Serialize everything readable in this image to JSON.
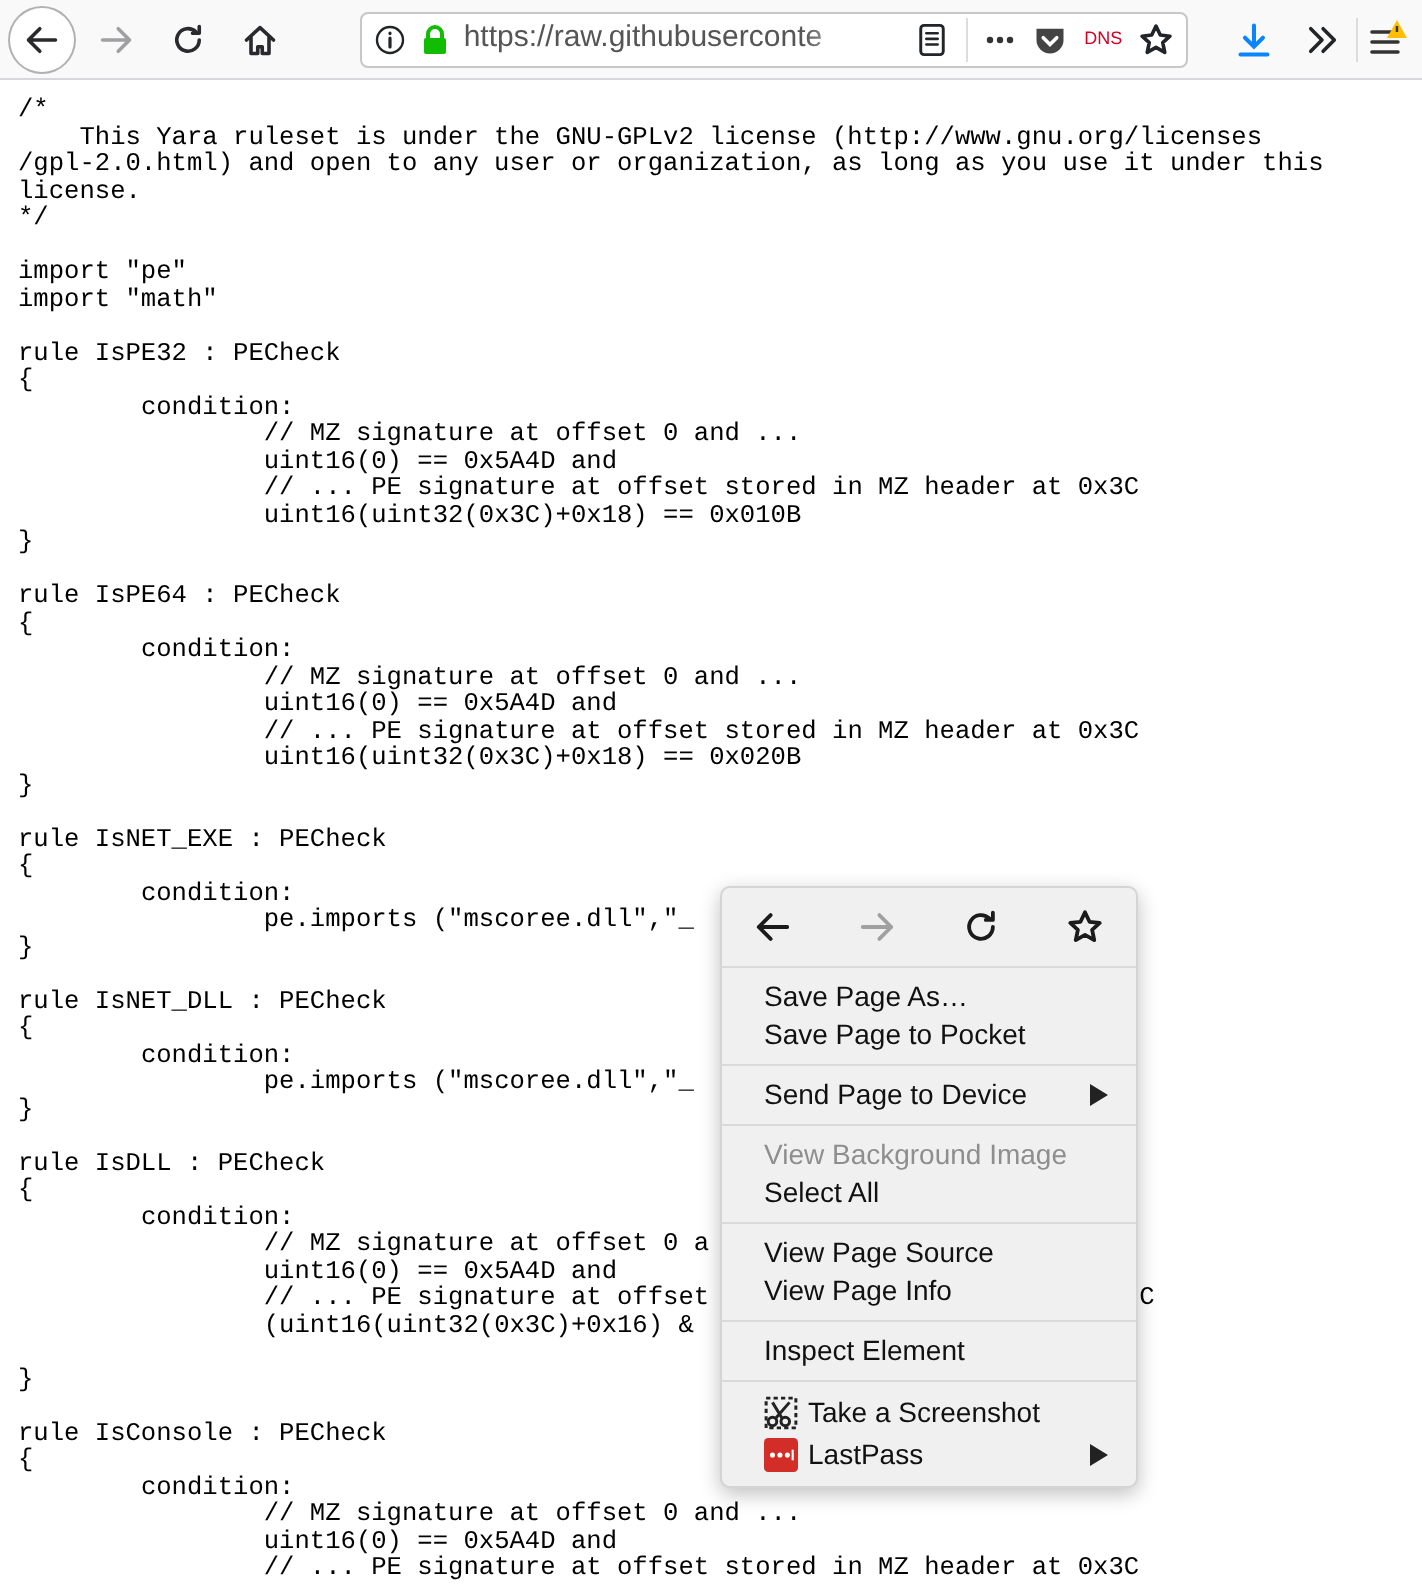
{
  "toolbar": {
    "nav_buttons": [
      {
        "kind": "back",
        "disabled": false
      },
      {
        "kind": "forward",
        "disabled": true
      },
      {
        "kind": "reload",
        "disabled": false
      },
      {
        "kind": "home",
        "disabled": false
      }
    ],
    "url": "https://raw.githubuserconte",
    "dns_label": "DNS",
    "menu_alert": true
  },
  "code": {
    "blocks": [
      [
        {
          "text": "/*"
        },
        {
          "text": "    This Yara ruleset is under the GNU-GPLv2 license (http://www.gnu.org/licenses"
        },
        {
          "text": "/gpl-2.0.html) and open to any user or organization, as long as you use it under this"
        },
        {
          "text": "license."
        },
        {
          "text": "*/"
        }
      ],
      [
        {
          "text": "import \"pe\""
        },
        {
          "text": "import \"math\""
        }
      ],
      [
        {
          "text": "rule IsPE32 : PECheck"
        },
        {
          "text": "{"
        },
        {
          "text": "\tcondition:"
        },
        {
          "text": "\t\t// MZ signature at offset 0 and ..."
        },
        {
          "text": "\t\tuint16(0) == 0x5A4D and"
        },
        {
          "text": "\t\t// ... PE signature at offset stored in MZ header at 0x3C"
        },
        {
          "text": "\t\tuint16(uint32(0x3C)+0x18) == 0x010B"
        },
        {
          "text": "}"
        }
      ],
      [
        {
          "text": "rule IsPE64 : PECheck"
        },
        {
          "text": "{"
        },
        {
          "text": "\tcondition:"
        },
        {
          "text": "\t\t// MZ signature at offset 0 and ..."
        },
        {
          "text": "\t\tuint16(0) == 0x5A4D and"
        },
        {
          "text": "\t\t// ... PE signature at offset stored in MZ header at 0x3C"
        },
        {
          "text": "\t\tuint16(uint32(0x3C)+0x18) == 0x020B"
        },
        {
          "text": "}"
        }
      ],
      [
        {
          "text": "rule IsNET_EXE : PECheck"
        },
        {
          "text": "{"
        },
        {
          "text": "\tcondition:"
        },
        {
          "text": "\t\tpe.imports (\"mscoree.dll\",\"_"
        },
        {
          "text": "}"
        }
      ],
      [
        {
          "text": "rule IsNET_DLL : PECheck"
        },
        {
          "text": "{"
        },
        {
          "text": "\tcondition:"
        },
        {
          "text": "\t\tpe.imports (\"mscoree.dll\",\"_"
        },
        {
          "text": "}"
        }
      ],
      [
        {
          "text": "rule IsDLL : PECheck"
        },
        {
          "text": "{"
        },
        {
          "text": "\tcondition:"
        },
        {
          "text": "\t\t// MZ signature at offset 0 a"
        },
        {
          "text": "\t\tuint16(0) == 0x5A4D and"
        },
        {
          "text": "\t\t// ... PE signature at offset",
          "tail": "C"
        },
        {
          "text": "\t\t(uint16(uint32(0x3C)+0x16) &"
        }
      ],
      [
        {
          "text": "}"
        }
      ],
      [
        {
          "text": "rule IsConsole : PECheck"
        },
        {
          "text": "{"
        },
        {
          "text": "\tcondition:"
        },
        {
          "text": "\t\t// MZ signature at offset 0 and ..."
        },
        {
          "text": "\t\tuint16(0) == 0x5A4D and"
        },
        {
          "text": "\t\t// ... PE signature at offset stored in MZ header at 0x3C"
        }
      ]
    ]
  },
  "context_menu": {
    "nav": [
      {
        "kind": "back",
        "disabled": false
      },
      {
        "kind": "forward",
        "disabled": true
      },
      {
        "kind": "reload",
        "disabled": false
      },
      {
        "kind": "bookmark",
        "disabled": false
      }
    ],
    "groups": [
      [
        {
          "label": "Save Page As…",
          "disabled": false,
          "submenu": false
        },
        {
          "label": "Save Page to Pocket",
          "disabled": false,
          "submenu": false
        }
      ],
      [
        {
          "label": "Send Page to Device",
          "disabled": false,
          "submenu": true
        }
      ],
      [
        {
          "label": "View Background Image",
          "disabled": true,
          "submenu": false
        },
        {
          "label": "Select All",
          "disabled": false,
          "submenu": false
        }
      ],
      [
        {
          "label": "View Page Source",
          "disabled": false,
          "submenu": false
        },
        {
          "label": "View Page Info",
          "disabled": false,
          "submenu": false
        }
      ],
      [
        {
          "label": "Inspect Element",
          "disabled": false,
          "submenu": false
        }
      ],
      [
        {
          "label": "Take a Screenshot",
          "disabled": false,
          "submenu": false,
          "kind": "screenshot"
        },
        {
          "label": "LastPass",
          "disabled": false,
          "submenu": true,
          "kind": "lastpass"
        }
      ]
    ]
  }
}
